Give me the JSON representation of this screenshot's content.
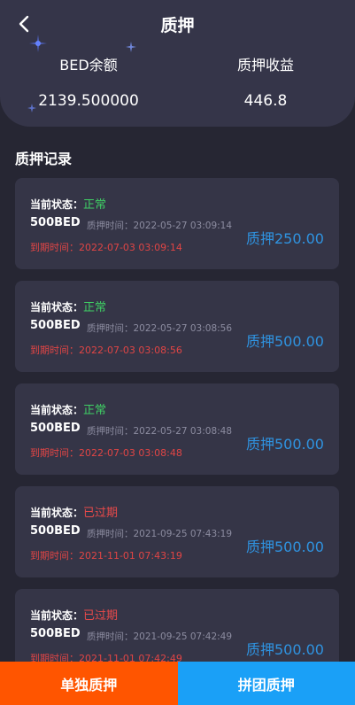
{
  "header": {
    "title": "质押",
    "bed_balance_label": "BED余额",
    "bed_balance_value": "2139.500000",
    "pledge_income_label": "质押收益",
    "pledge_income_value": "446.8"
  },
  "section_title": "质押记录",
  "labels": {
    "status_prefix": "当前状态：",
    "start_prefix": "质押时间：",
    "expire_prefix": "到期时间："
  },
  "records": [
    {
      "status": "正常",
      "amount": "500BED",
      "start_time": "2022-05-27 03:09:14",
      "expire_time": "2022-07-03 03:09:14",
      "pledge": "质押250.00"
    },
    {
      "status": "正常",
      "amount": "500BED",
      "start_time": "2022-05-27 03:08:56",
      "expire_time": "2022-07-03 03:08:56",
      "pledge": "质押500.00"
    },
    {
      "status": "正常",
      "amount": "500BED",
      "start_time": "2022-05-27 03:08:48",
      "expire_time": "2022-07-03 03:08:48",
      "pledge": "质押500.00"
    },
    {
      "status": "已过期",
      "amount": "500BED",
      "start_time": "2021-09-25 07:43:19",
      "expire_time": "2021-11-01 07:43:19",
      "pledge": "质押500.00"
    },
    {
      "status": "已过期",
      "amount": "500BED",
      "start_time": "2021-09-25 07:42:49",
      "expire_time": "2021-11-01 07:42:49",
      "pledge": "质押500.00"
    }
  ],
  "bottom": {
    "single_label": "单独质押",
    "group_label": "拼团质押"
  },
  "colors": {
    "status_normal": "#3fcf64",
    "status_expired": "#e84a4a",
    "single_button": "#ff5500",
    "group_button": "#1aa0f7",
    "pledge_amount": "#2f93e0"
  }
}
